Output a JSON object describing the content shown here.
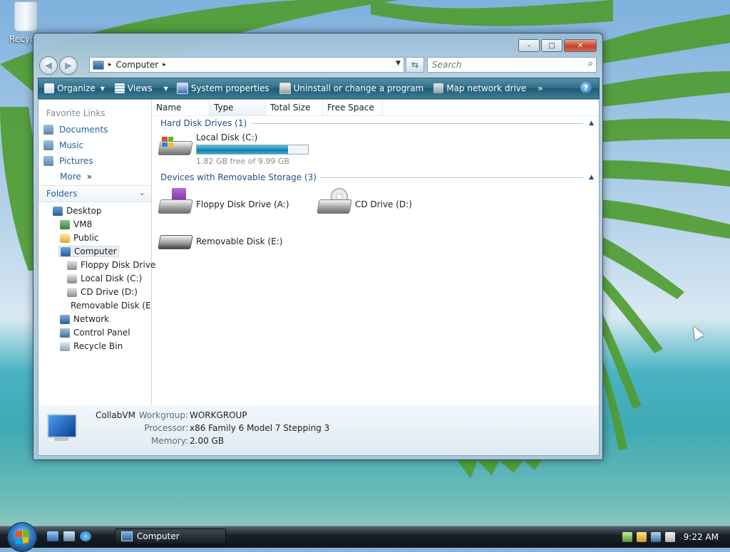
{
  "desktop": {
    "recycle_label": "Recycle"
  },
  "window": {
    "caption_buttons": {
      "minimize": "–",
      "maximize": "□",
      "close": "✕"
    },
    "nav": {
      "back": "◀",
      "forward": "▶"
    },
    "address": {
      "crumb": "Computer",
      "crumb_arrow": "▸",
      "crumb_arrow_after": "▸",
      "dropdown": "▼"
    },
    "refresh_glyph": "⇆",
    "search": {
      "placeholder": "Search",
      "icon": "⌕"
    },
    "toolbar": {
      "organize": "Organize",
      "views": "Views",
      "system_properties": "System properties",
      "uninstall": "Uninstall or change a program",
      "map_network": "Map network drive",
      "more": "»",
      "help": "?",
      "dropdown": "▼"
    },
    "favorites": {
      "title": "Favorite Links",
      "items": [
        "Documents",
        "Music",
        "Pictures"
      ],
      "more": "More",
      "more_chevron": "»"
    },
    "folders": {
      "title": "Folders",
      "chevron": "⌄",
      "tree": [
        "Desktop",
        "VM8",
        "Public",
        "Computer",
        "Floppy Disk Drive",
        "Local Disk (C:)",
        "CD Drive (D:)",
        "Removable Disk (E:)",
        "Network",
        "Control Panel",
        "Recycle Bin"
      ]
    },
    "columns": {
      "name": "Name",
      "type": "Type",
      "total_size": "Total Size",
      "free_space": "Free Space"
    },
    "groups": {
      "hard_disks": "Hard Disk Drives (1)",
      "removable": "Devices with Removable Storage (3)",
      "collapse_glyph": "▲"
    },
    "drives": {
      "local_c": {
        "label": "Local Disk (C:)",
        "free": "1.82 GB free of 9.99 GB",
        "used_fraction": 0.818
      },
      "floppy": {
        "label": "Floppy Disk Drive (A:)"
      },
      "cd": {
        "label": "CD Drive (D:)"
      },
      "removable_e": {
        "label": "Removable Disk (E:)"
      }
    },
    "details": {
      "computer_name": "CollabVM",
      "workgroup_label": "Workgroup:",
      "workgroup_value": "WORKGROUP",
      "processor_label": "Processor:",
      "processor_value": "x86 Family 6 Model 7 Stepping 3",
      "memory_label": "Memory:",
      "memory_value": "2.00 GB"
    }
  },
  "taskbar": {
    "task_button_label": "Computer",
    "clock": "9:22 AM"
  },
  "colors": {
    "accent_blue": "#1f5e9c",
    "toolbar_teal": "#2f6c86",
    "meter_fill": "#1b8fb7"
  }
}
